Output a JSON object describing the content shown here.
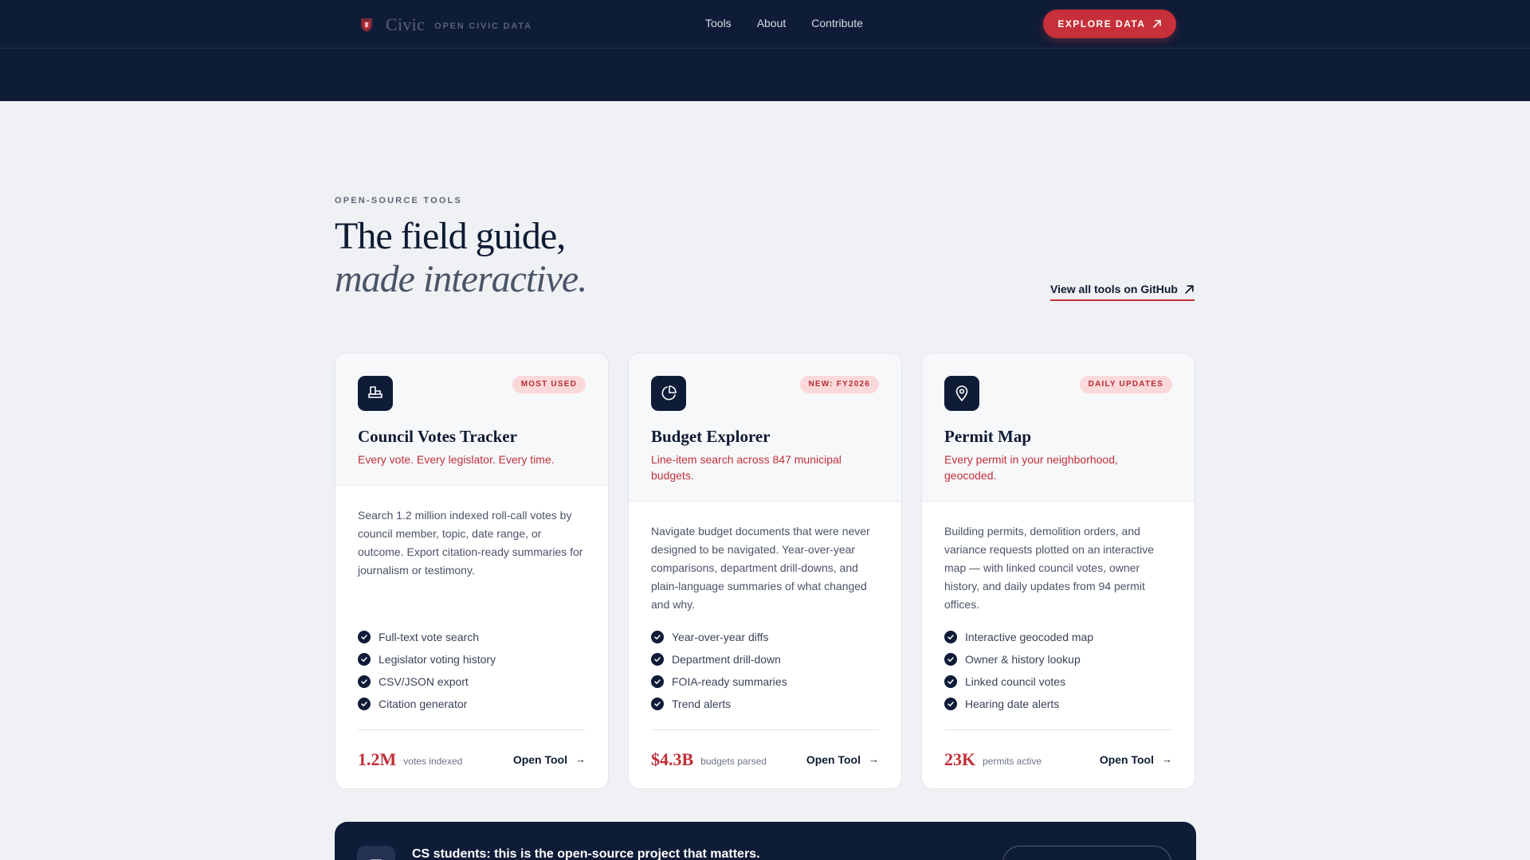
{
  "header": {
    "brand_name": "Civic",
    "brand_tag": "OPEN CIVIC DATA",
    "nav": [
      "Tools",
      "About",
      "Contribute"
    ],
    "cta_label": "EXPLORE DATA"
  },
  "section": {
    "eyebrow": "OPEN-SOURCE TOOLS",
    "title_line1": "The field guide,",
    "title_line2": "made interactive.",
    "github_link": "View all tools on GitHub"
  },
  "cards": [
    {
      "icon": "podium-icon",
      "badge": "MOST USED",
      "title": "Council Votes Tracker",
      "tagline": "Every vote. Every legislator. Every time.",
      "description": "Search 1.2 million indexed roll-call votes by council member, topic, date range, or outcome. Export citation-ready summaries for journalism or testimony.",
      "features": [
        "Full-text vote search",
        "Legislator voting history",
        "CSV/JSON export",
        "Citation generator"
      ],
      "stat_value": "1.2M",
      "stat_label": "votes indexed",
      "action": "Open Tool"
    },
    {
      "icon": "pie-chart-icon",
      "badge": "NEW: FY2026",
      "title": "Budget Explorer",
      "tagline": "Line-item search across 847 municipal budgets.",
      "description": "Navigate budget documents that were never designed to be navigated. Year-over-year comparisons, department drill-downs, and plain-language summaries of what changed and why.",
      "features": [
        "Year-over-year diffs",
        "Department drill-down",
        "FOIA-ready summaries",
        "Trend alerts"
      ],
      "stat_value": "$4.3B",
      "stat_label": "budgets parsed",
      "action": "Open Tool"
    },
    {
      "icon": "map-pin-icon",
      "badge": "DAILY UPDATES",
      "title": "Permit Map",
      "tagline": "Every permit in your neighborhood, geocoded.",
      "description": "Building permits, demolition orders, and variance requests plotted on an interactive map — with linked council votes, owner history, and daily updates from 94 permit offices.",
      "features": [
        "Interactive geocoded map",
        "Owner & history lookup",
        "Linked council votes",
        "Hearing date alerts"
      ],
      "stat_value": "23K",
      "stat_label": "permits active",
      "action": "Open Tool"
    }
  ],
  "banner": {
    "text": "CS students: this is the open-source project that matters."
  },
  "colors": {
    "navy": "#0f1c38",
    "accent": "#c7303a",
    "background": "#eff1f4"
  }
}
